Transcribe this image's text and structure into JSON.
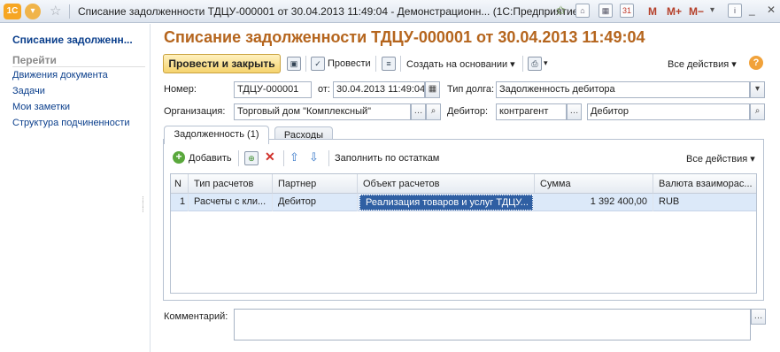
{
  "titlebar": {
    "logo": "1С",
    "title": "Списание задолженности ТДЦУ-000001 от 30.04.2013 11:49:04 - Демонстрационн... (1С:Предприятие)",
    "m": "M",
    "mplus": "M+",
    "mminus": "M−"
  },
  "sidebar": {
    "title": "Списание задолженн...",
    "goto": "Перейти",
    "items": [
      "Движения документа",
      "Задачи",
      "Мои заметки",
      "Структура подчиненности"
    ]
  },
  "doc": {
    "title": "Списание задолженности ТДЦУ-000001 от 30.04.2013 11:49:04"
  },
  "toolbar": {
    "post_close": "Провести и закрыть",
    "post": "Провести",
    "create_based": "Создать на основании",
    "all_actions": "Все действия",
    "help": "?"
  },
  "form": {
    "number_label": "Номер:",
    "number": "ТДЦУ-000001",
    "date_label": "от:",
    "date": "30.04.2013 11:49:04",
    "debt_type_label": "Тип долга:",
    "debt_type": "Задолженность дебитора",
    "org_label": "Организация:",
    "org": "Торговый дом \"Комплексный\"",
    "debtor_label": "Дебитор:",
    "debtor_kind": "контрагент",
    "debtor": "Дебитор"
  },
  "tabs": [
    "Задолженность (1)",
    "Расходы"
  ],
  "table_toolbar": {
    "add": "Добавить",
    "fill": "Заполнить по остаткам",
    "all_actions": "Все действия"
  },
  "table": {
    "columns": [
      "N",
      "Тип расчетов",
      "Партнер",
      "Объект расчетов",
      "Сумма",
      "Валюта взаиморас..."
    ],
    "rows": [
      [
        "1",
        "Расчеты с кли...",
        "Дебитор",
        "Реализация товаров и услуг ТДЦУ...",
        "1 392 400,00",
        "RUB"
      ]
    ]
  },
  "comment": {
    "label": "Комментарий:"
  },
  "colors": {
    "title_orange": "#b5651d",
    "link_blue": "#0b3f8c",
    "selected_row": "#dce9f9",
    "accent_yellow": "#f5d36e"
  },
  "icons": {
    "help": "question-icon",
    "search": "magnifier-icon",
    "ellipsis": "ellipsis-icon"
  }
}
